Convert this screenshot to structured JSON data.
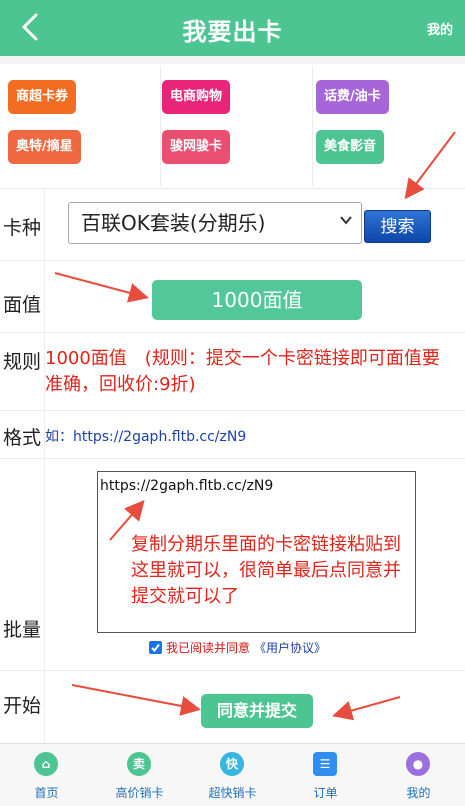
{
  "header": {
    "title": "我要出卡",
    "mine": "我的"
  },
  "categories": [
    {
      "label": "商超卡券",
      "color": "#f26d22"
    },
    {
      "label": "电商购物",
      "color": "#e9257a"
    },
    {
      "label": "话费/油卡",
      "color": "#a766d8"
    },
    {
      "label": "奥特/摘星",
      "color": "#f0683f"
    },
    {
      "label": "骏网骏卡",
      "color": "#ea4f72"
    },
    {
      "label": "美食影音",
      "color": "#4cc592"
    }
  ],
  "form": {
    "card_type_label": "卡种",
    "card_type_value": "百联OK套装(分期乐)",
    "search_label": "搜索",
    "face_value_label": "面值",
    "face_value": "1000面值",
    "rule_label": "规则",
    "rule_text": "1000面值　(规则：提交一个卡密链接即可面值要准确，回收价:9折)",
    "format_label": "格式",
    "format_text": "如：https://2gaph.fltb.cc/zN9",
    "batch_label": "批量",
    "batch_value": "https://2gaph.fltb.cc/zN9",
    "overlay_note": "复制分期乐里面的卡密链接粘贴到这里就可以，很简单最后点同意并提交就可以了",
    "agree_text": "我已阅读并同意",
    "agree_link": "《用户协议》",
    "agree_checked": true,
    "start_label": "开始",
    "submit_label": "同意并提交"
  },
  "tabs": [
    {
      "label": "首页",
      "icon": "home-icon",
      "color": "#4cc592",
      "glyph": "⌂"
    },
    {
      "label": "高价销卡",
      "icon": "sell-icon",
      "color": "#4cc592",
      "glyph": "卖"
    },
    {
      "label": "超快销卡",
      "icon": "fast-icon",
      "color": "#36b6e0",
      "glyph": "快"
    },
    {
      "label": "订单",
      "icon": "order-icon",
      "color": "#2f8ef0",
      "glyph": "☰"
    },
    {
      "label": "我的",
      "icon": "user-icon",
      "color": "#9b6fe0",
      "glyph": "●"
    }
  ],
  "annotation_color": "#e74c3c"
}
